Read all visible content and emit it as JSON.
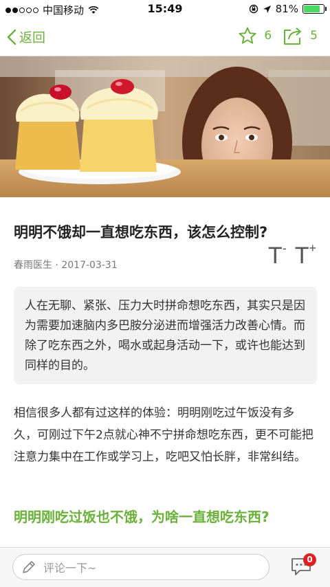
{
  "status_bar": {
    "carrier": "中国移动",
    "time": "15:49",
    "battery": "81%",
    "battery_level": 0.81,
    "battery_color": "#4cd964"
  },
  "nav": {
    "back_label": "返回",
    "favorite_count": "6",
    "share_count": "5",
    "accent_color": "#6ab13a"
  },
  "hero": {
    "icon": "cupcakes-woman-photo"
  },
  "article": {
    "title": "明明不饿却一直想吃东西，该怎么控制?",
    "author": "春雨医生 ·",
    "date": "2017-03-31",
    "font_decrease": "T",
    "font_decrease_sup": "-",
    "font_increase": "T",
    "font_increase_sup": "+",
    "summary": "人在无聊、紧张、压力大时拼命想吃东西，其实只是因为需要加速脑内多巴胺分泌进而增强活力改善心情。而除了吃东西之外，喝水或起身活动一下，或许也能达到同样的目的。",
    "paragraph_1": "相信很多人都有过这样的体验：明明刚吃过午饭没有多久，可刚过下午2点就心神不宁拼命想吃东西，更不可能把注意力集中在工作或学习上，吃吧又怕长胖，非常纠结。",
    "subheading_1": "明明刚吃过饭也不饿，为啥一直想吃东西?"
  },
  "bottom_bar": {
    "comment_placeholder": "评论一下~",
    "comment_badge": "0"
  }
}
